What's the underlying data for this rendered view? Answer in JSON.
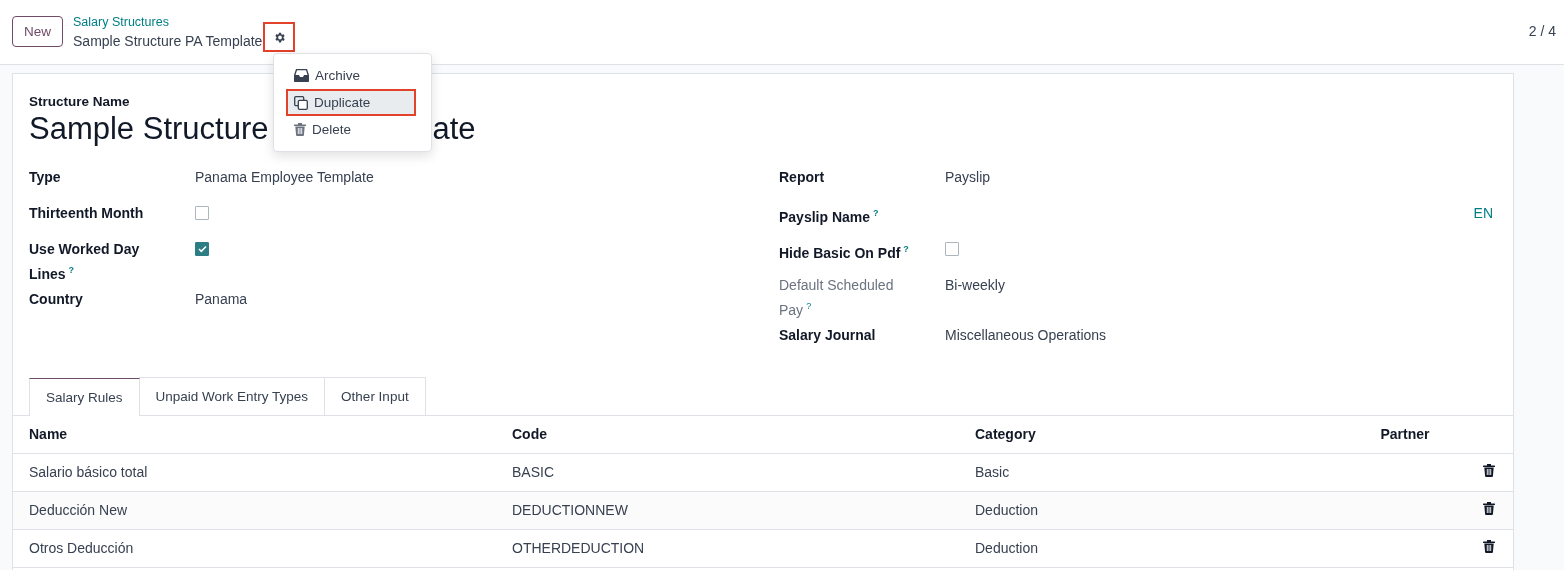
{
  "control_panel": {
    "new_button": "New",
    "breadcrumb": "Salary Structures",
    "record_title": "Sample Structure PA Template",
    "gear_annotated": true,
    "pager": "2 / 4"
  },
  "action_menu": {
    "items": [
      {
        "label": "Archive",
        "hovered": false,
        "annotated": false
      },
      {
        "label": "Duplicate",
        "hovered": true,
        "annotated": true
      },
      {
        "label": "Delete",
        "hovered": false,
        "annotated": false
      }
    ]
  },
  "form": {
    "name_label": "Structure Name",
    "name_visible_start": "Sample Structure",
    "name_visible_end": "ate",
    "left_fields": [
      {
        "label": "Type",
        "kind": "text",
        "value": "Panama Employee Template",
        "help": false,
        "muted": false
      },
      {
        "label": "Thirteenth Month",
        "kind": "checkbox",
        "checked": false,
        "help": false,
        "muted": false
      },
      {
        "label": "Use Worked Day Lines",
        "kind": "checkbox",
        "checked": true,
        "help": true,
        "muted": false
      },
      {
        "label": "Country",
        "kind": "text",
        "value": "Panama",
        "help": false,
        "muted": false
      }
    ],
    "right_fields": [
      {
        "label": "Report",
        "kind": "text",
        "value": "Payslip",
        "help": false,
        "muted": false
      },
      {
        "label": "Payslip Name",
        "kind": "translatable",
        "lang": "EN",
        "help": true,
        "muted": false
      },
      {
        "label": "Hide Basic On Pdf",
        "kind": "checkbox",
        "checked": false,
        "help": true,
        "muted": false
      },
      {
        "label": "Default Scheduled Pay",
        "kind": "text",
        "value": "Bi-weekly",
        "help": true,
        "muted": true
      },
      {
        "label": "Salary Journal",
        "kind": "text",
        "value": "Miscellaneous Operations",
        "help": false,
        "muted": false
      }
    ],
    "help_mark": "?",
    "tabs": [
      {
        "label": "Salary Rules",
        "selected": true
      },
      {
        "label": "Unpaid Work Entry Types",
        "selected": false
      },
      {
        "label": "Other Input",
        "selected": false
      }
    ],
    "table": {
      "columns": [
        "Name",
        "Code",
        "Category",
        "Partner"
      ],
      "rows": [
        {
          "name": "Salario básico total",
          "code": "BASIC",
          "category": "Basic"
        },
        {
          "name": "Deducción New",
          "code": "DEDUCTIONNEW",
          "category": "Deduction"
        },
        {
          "name": "Otros Deducción",
          "code": "OTHERDEDUCTION",
          "category": "Deduction"
        }
      ]
    }
  }
}
